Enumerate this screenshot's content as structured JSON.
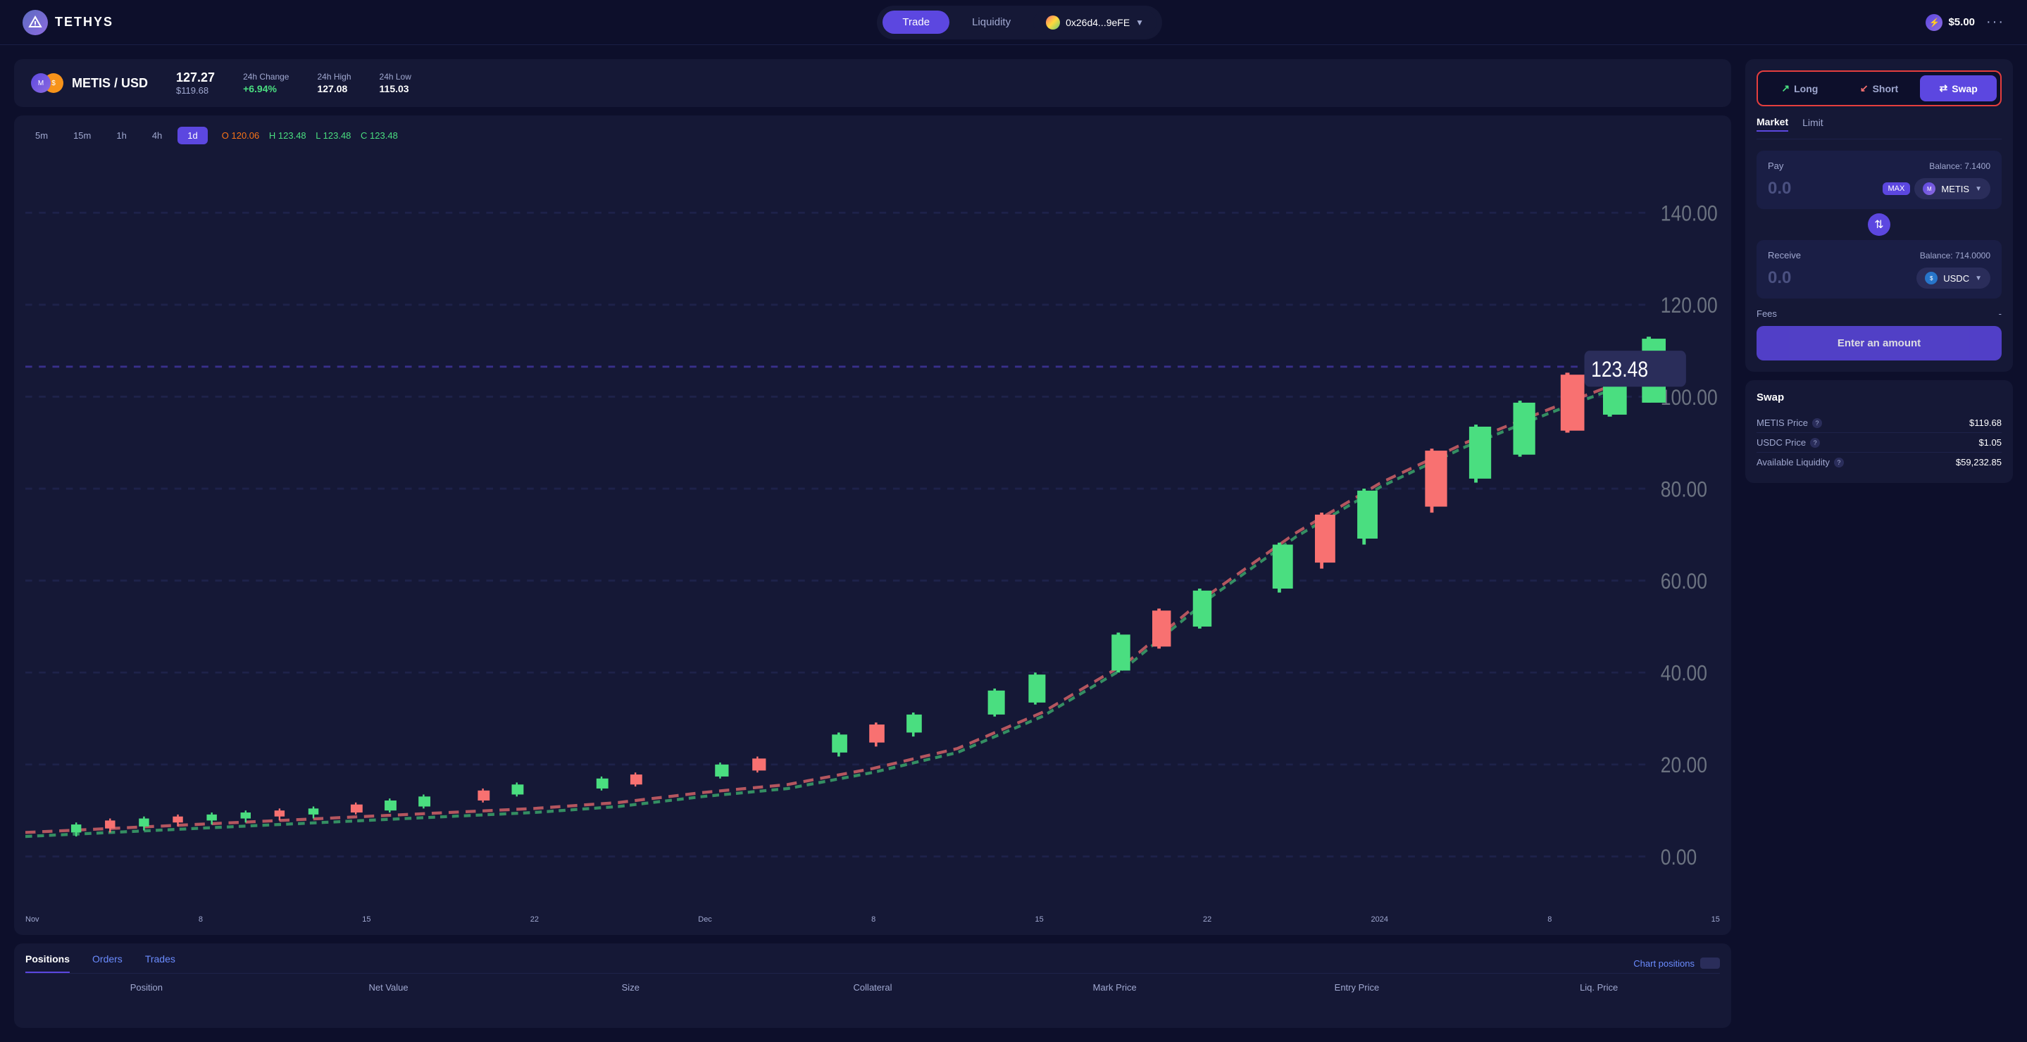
{
  "header": {
    "logo_text": "TETHYS",
    "nav": {
      "trade_label": "Trade",
      "liquidity_label": "Liquidity",
      "wallet_address": "0x26d4...9eFE"
    },
    "price": "$5.00"
  },
  "market": {
    "pair": "METIS / USD",
    "price_main": "127.27",
    "price_sub": "$119.68",
    "change_label": "24h Change",
    "change_value": "+6.94%",
    "high_label": "24h High",
    "high_value": "127.08",
    "low_label": "24h Low",
    "low_value": "115.03"
  },
  "chart": {
    "time_buttons": [
      "5m",
      "15m",
      "1h",
      "4h",
      "1d"
    ],
    "active_time": "1d",
    "ohlc": {
      "o_label": "O",
      "o_value": "120.06",
      "h_label": "H",
      "h_value": "123.48",
      "l_label": "L",
      "l_value": "123.48",
      "c_label": "C",
      "c_value": "123.48"
    },
    "price_label": "123.48",
    "y_labels": [
      "140.00",
      "120.00",
      "100.00",
      "80.00",
      "60.00",
      "40.00",
      "20.00",
      "0.00"
    ],
    "x_labels": [
      "Nov",
      "8",
      "15",
      "22",
      "Dec",
      "8",
      "15",
      "22",
      "2024",
      "8",
      "15"
    ]
  },
  "bottom_tabs": {
    "positions_label": "Positions",
    "orders_label": "Orders",
    "trades_label": "Trades",
    "chart_positions_label": "Chart positions",
    "table_headers": [
      "Position",
      "Net Value",
      "Size",
      "Collateral",
      "Mark Price",
      "Entry Price",
      "Liq. Price"
    ]
  },
  "trading": {
    "tabs": {
      "long_label": "Long",
      "short_label": "Short",
      "swap_label": "Swap"
    },
    "order_types": {
      "market_label": "Market",
      "limit_label": "Limit"
    },
    "pay": {
      "label": "Pay",
      "balance_label": "Balance: 7.1400",
      "amount": "0.0",
      "max_label": "MAX",
      "token": "METIS"
    },
    "receive": {
      "label": "Receive",
      "balance_label": "Balance: 714.0000",
      "amount": "0.0",
      "token": "USDC"
    },
    "fees_label": "Fees",
    "fees_value": "-",
    "enter_amount_label": "Enter an amount"
  },
  "swap_info": {
    "title": "Swap",
    "rows": [
      {
        "label": "METIS Price",
        "value": "$119.68"
      },
      {
        "label": "USDC Price",
        "value": "$1.05"
      },
      {
        "label": "Available Liquidity",
        "value": "$59,232.85"
      }
    ]
  }
}
